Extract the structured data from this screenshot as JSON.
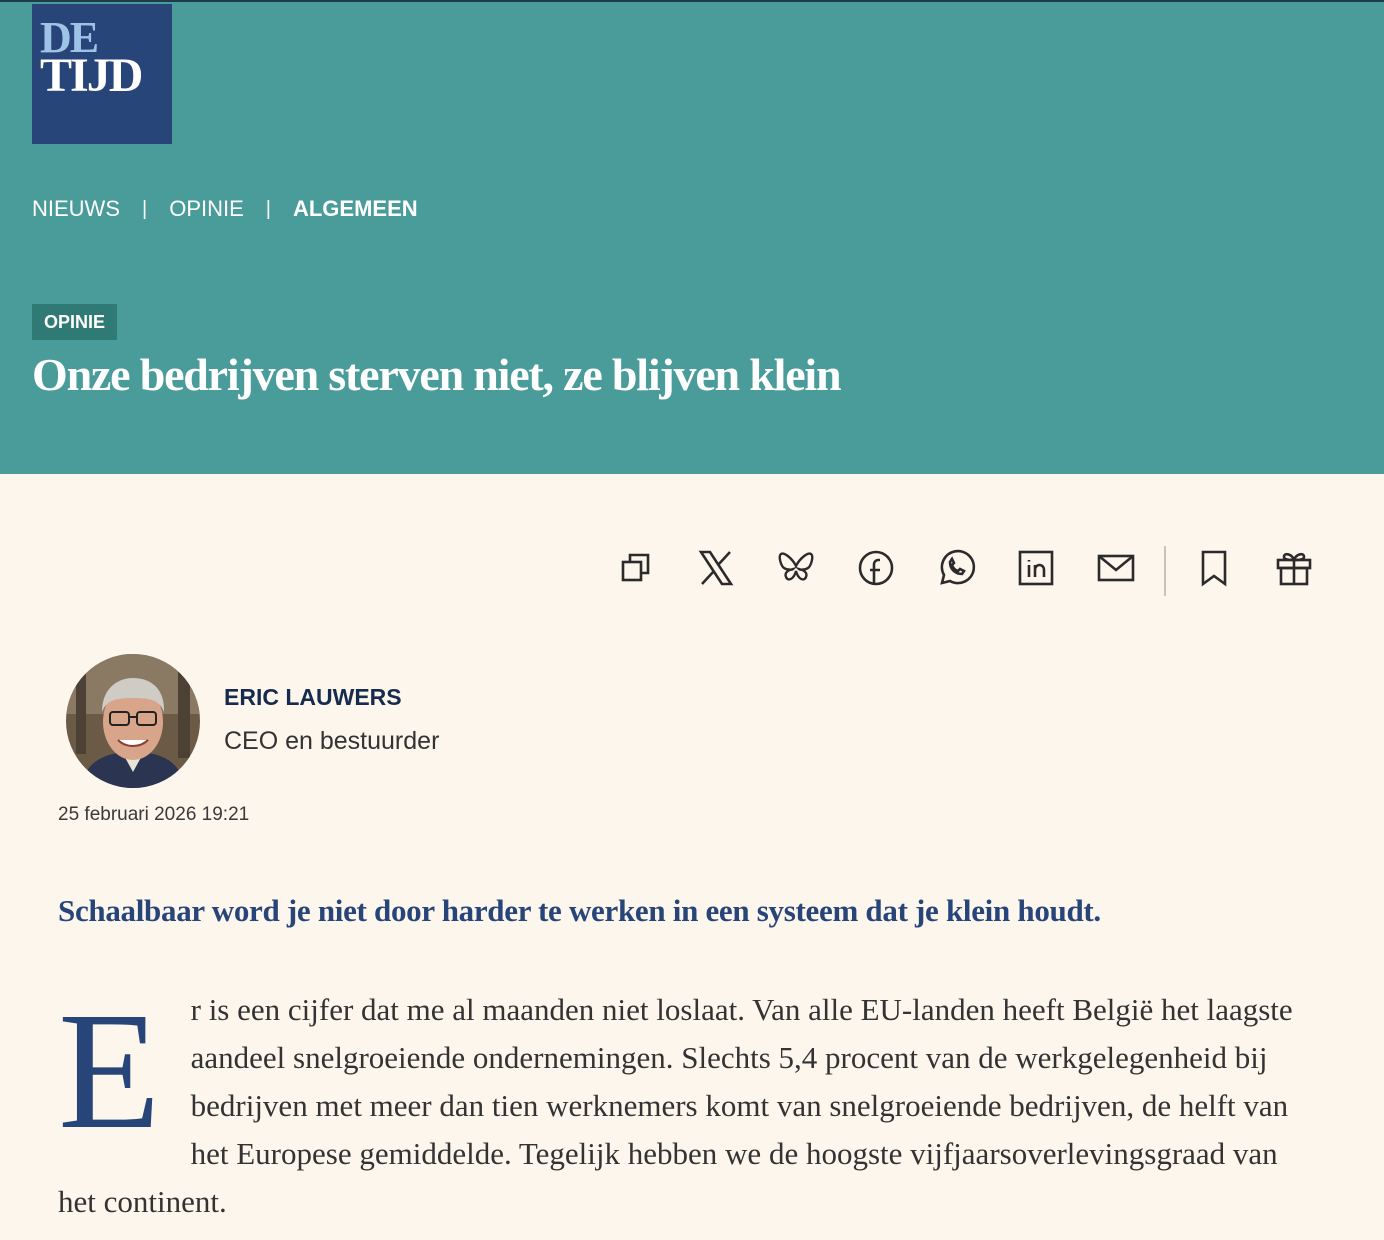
{
  "logo": {
    "line1": "DE",
    "line2": "TIJD"
  },
  "breadcrumb": {
    "items": [
      "NIEUWS",
      "OPINIE",
      "ALGEMEEN"
    ],
    "separator": "|"
  },
  "article": {
    "badge": "OPINIE",
    "title": "Onze bedrijven sterven niet, ze blijven klein",
    "lead": "Schaalbaar word je niet door harder te werken in een systeem dat je klein houdt.",
    "drop_cap": "E",
    "body": "r is een cijfer dat me al maanden niet loslaat. Van alle EU-landen heeft België het laagste aandeel snelgroeiende ondernemingen. Slechts 5,4 procent van de werkgelegenheid bij bedrijven met meer dan tien werknemers komt van snelgroeiende bedrijven, de helft van het Europese gemiddelde. Tegelijk hebben we de hoogste vijfjaarsoverlevingsgraad van het continent."
  },
  "author": {
    "name": "ERIC LAUWERS",
    "role": "CEO en bestuurder"
  },
  "date": "25 februari 2026 19:21",
  "toolbar": {
    "icons": [
      "copy-icon",
      "x-icon",
      "bluesky-icon",
      "facebook-icon",
      "whatsapp-icon",
      "linkedin-icon",
      "mail-icon",
      "bookmark-icon",
      "gift-icon"
    ]
  },
  "colors": {
    "header_bg": "#4a9c9a",
    "logo_bg": "#28457a",
    "badge_bg": "#2f7a74",
    "page_bg": "#fcf6ec",
    "accent": "#28457a",
    "author_name": "#162b4d"
  }
}
